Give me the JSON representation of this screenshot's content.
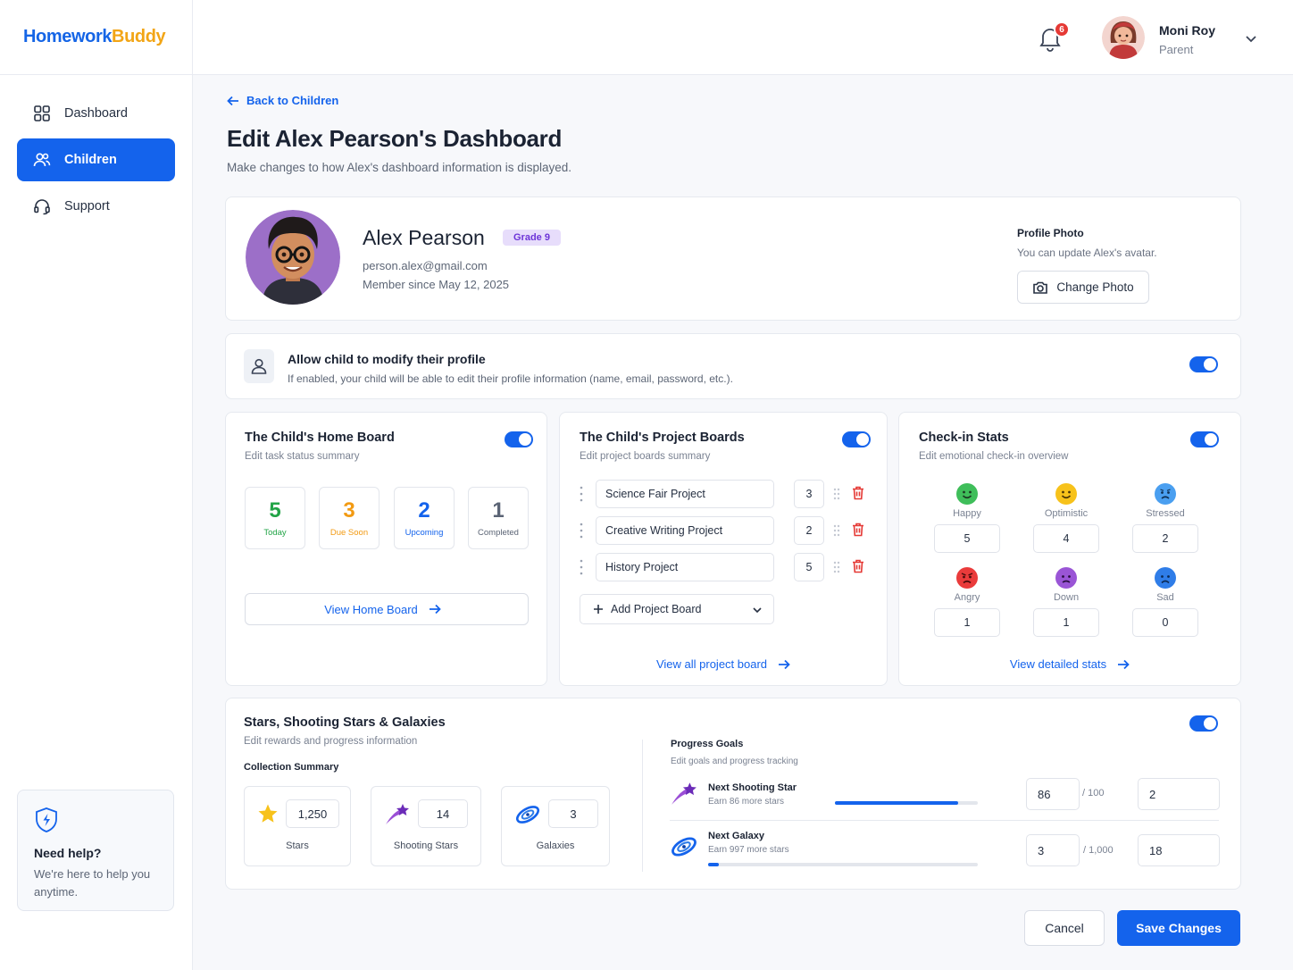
{
  "app": {
    "logo_part1": "Homework",
    "logo_part2": "Buddy"
  },
  "sidebar": {
    "items": [
      {
        "label": "Dashboard",
        "icon": "grid-icon",
        "active": false
      },
      {
        "label": "Children",
        "icon": "users-icon",
        "active": true
      },
      {
        "label": "Support",
        "icon": "headset-icon",
        "active": false
      }
    ],
    "help": {
      "title": "Need help?",
      "text": "We're here to help you anytime."
    }
  },
  "topbar": {
    "notification_count": "6",
    "user_name": "Moni Roy",
    "user_role": "Parent"
  },
  "page": {
    "back_label": "Back to Children",
    "title": "Edit Alex Pearson's Dashboard",
    "subtitle": "Make changes to how Alex's dashboard information is displayed."
  },
  "profile": {
    "name": "Alex Pearson",
    "grade": "Grade 9",
    "email": "person.alex@gmail.com",
    "member_since": "Member since May 12, 2025",
    "photo_title": "Profile Photo",
    "photo_sub": "You can update Alex's avatar.",
    "change_photo_label": "Change Photo"
  },
  "allow_modify": {
    "title": "Allow child to modify their profile",
    "subtitle": "If enabled, your child will be able to edit their profile information (name, email, password, etc.).",
    "enabled": true
  },
  "home_board": {
    "title": "The Child's Home Board",
    "subtitle": "Edit task status summary",
    "enabled": true,
    "stats": [
      {
        "value": "5",
        "label": "Today",
        "color": "#22a447"
      },
      {
        "value": "3",
        "label": "Due Soon",
        "color": "#f29a12"
      },
      {
        "value": "2",
        "label": "Upcoming",
        "color": "#1463ec"
      },
      {
        "value": "1",
        "label": "Completed",
        "color": "#5b6475"
      }
    ],
    "view_label": "View Home Board"
  },
  "project_boards": {
    "title": "The Child's Project Boards",
    "subtitle": "Edit project boards summary",
    "enabled": true,
    "projects": [
      {
        "name": "Science Fair Project",
        "count": "3"
      },
      {
        "name": "Creative Writing Project",
        "count": "2"
      },
      {
        "name": "History Project",
        "count": "5"
      }
    ],
    "add_label": "Add Project Board",
    "view_label": "View all project board"
  },
  "checkin": {
    "title": "Check-in Stats",
    "subtitle": "Edit emotional check-in overview",
    "enabled": true,
    "emotions": [
      {
        "label": "Happy",
        "value": "5",
        "color": "#3fbe5a",
        "mood": "happy"
      },
      {
        "label": "Optimistic",
        "value": "4",
        "color": "#f7c21b",
        "mood": "happy"
      },
      {
        "label": "Stressed",
        "value": "2",
        "color": "#4a9ff0",
        "mood": "stressed"
      },
      {
        "label": "Angry",
        "value": "1",
        "color": "#ea3b3b",
        "mood": "angry"
      },
      {
        "label": "Down",
        "value": "1",
        "color": "#9a55d6",
        "mood": "sad"
      },
      {
        "label": "Sad",
        "value": "0",
        "color": "#2f7de8",
        "mood": "sad"
      }
    ],
    "view_label": "View detailed stats"
  },
  "stars": {
    "title": "Stars, Shooting Stars & Galaxies",
    "subtitle": "Edit rewards and progress information",
    "enabled": true,
    "collection_title": "Collection Summary",
    "collection": [
      {
        "value": "1,250",
        "label": "Stars",
        "icon": "star-icon"
      },
      {
        "value": "14",
        "label": "Shooting Stars",
        "icon": "shooting-star-icon"
      },
      {
        "value": "3",
        "label": "Galaxies",
        "icon": "galaxy-icon"
      }
    ],
    "goals_title": "Progress Goals",
    "goals_subtitle": "Edit goals and progress tracking",
    "goals": [
      {
        "title": "Next Shooting Star",
        "sub": "Earn 86 more stars",
        "progress": 0.86,
        "current": "86",
        "denom": "/ 100",
        "target": "2",
        "icon": "shooting-star-icon"
      },
      {
        "title": "Next Galaxy",
        "sub": "Earn 997 more stars",
        "progress": 0.03,
        "current": "3",
        "denom": "/ 1,000",
        "target": "18",
        "icon": "galaxy-icon"
      }
    ]
  },
  "actions": {
    "cancel_label": "Cancel",
    "save_label": "Save Changes"
  }
}
